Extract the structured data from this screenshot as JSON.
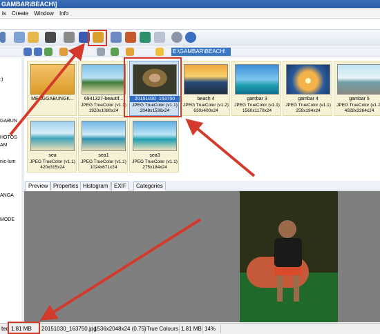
{
  "window": {
    "title": "GAMBAR\\BEACH\\]"
  },
  "menu": {
    "items": [
      "ls",
      "Create",
      "Window",
      "Info"
    ]
  },
  "address": {
    "path": "E:\\GAMBAR\\BEACH\\"
  },
  "tree": {
    "items": [
      ":)",
      "GABUN",
      "HOTOS",
      "AM",
      "nic-lum",
      "ANGA",
      "MODE"
    ]
  },
  "thumbnails": [
    {
      "name": "MENGGABUNGK...",
      "type": "",
      "dims": "",
      "kind": "folder"
    },
    {
      "name": "6941327-beautif...",
      "type": "JPEG TrueColor (v1.1)",
      "dims": "1920x1080x24",
      "kind": "beach1"
    },
    {
      "name": "20151030_163750",
      "type": "JPEG TrueColor (v1.1)",
      "dims": "2048x1536x24",
      "kind": "boy"
    },
    {
      "name": "beach 4",
      "type": "JPEG TrueColor (v1.2)",
      "dims": "630x400x24",
      "kind": "sunset"
    },
    {
      "name": "gambar 3",
      "type": "JPEG TrueColor (v1.1)",
      "dims": "1560x1170x24",
      "kind": "island"
    },
    {
      "name": "gambar 4",
      "type": "JPEG TrueColor (v1.1)",
      "dims": "259x194x24",
      "kind": "sunrise"
    },
    {
      "name": "gambar 5",
      "type": "JPEG TrueColor (v1.2)",
      "dims": "4928x3264x24",
      "kind": "rocks"
    },
    {
      "name": "sea",
      "type": "JPEG TrueColor (v1.1)",
      "dims": "420x315x24",
      "kind": "sea"
    },
    {
      "name": "sea1",
      "type": "JPEG TrueColor (v1.1)",
      "dims": "1024x671x24",
      "kind": "sea1"
    },
    {
      "name": "sea3",
      "type": "JPEG TrueColor (v1.1)",
      "dims": "275x184x24",
      "kind": "sea3"
    }
  ],
  "tabs": [
    "Preview",
    "Properties",
    "Histogram",
    "EXIF",
    "Categories"
  ],
  "status": {
    "selected": "ted",
    "size": "1.81 MB",
    "file": "20151030_163750.jpg",
    "dims": "1536x2048x24 (0.75)",
    "colors": "True Colours",
    "mem": "1.81 MB",
    "zoom": "14%"
  },
  "colors": {
    "annotation": "#d33a2c",
    "selection": "#2d6bc4"
  }
}
